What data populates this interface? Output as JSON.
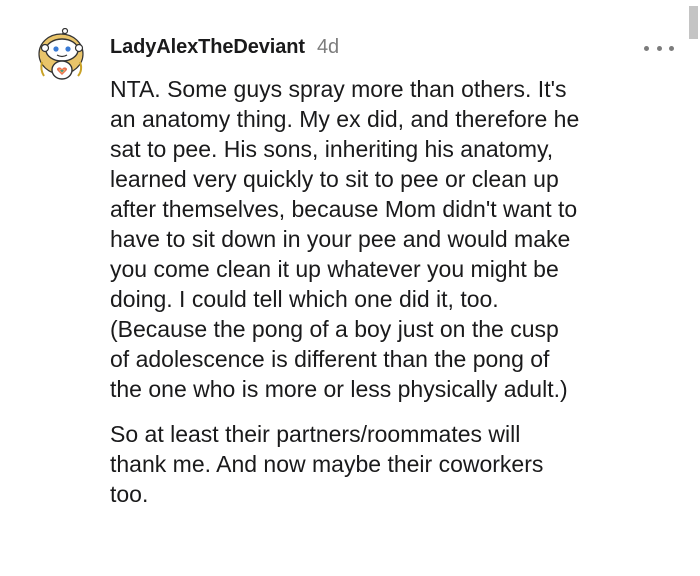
{
  "comment": {
    "username": "LadyAlexTheDeviant",
    "timestamp": "4d",
    "more_icon": "more-options-icon",
    "avatar_icon": "reddit-snoo-avatar-icon",
    "paragraphs": [
      {
        "lines": [
          "NTA. Some guys spray more than others. It's",
          "an anatomy thing. My ex did, and therefore he",
          "sat to pee. His sons, inheriting his anatomy,",
          "learned very quickly to sit to pee or clean up",
          "after themselves, because Mom didn't want to",
          "have to sit down in your pee and would make",
          "you come clean it up whatever you might be",
          "doing. I could tell which one did it, too.",
          "(Because the pong of a boy just on the cusp",
          "of adolescence is different than the pong of",
          "the one who is more or less physically adult.)"
        ]
      },
      {
        "lines": [
          "So at least their partners/roommates will",
          "thank me. And now maybe their coworkers",
          "too."
        ]
      }
    ]
  },
  "colors": {
    "text": "#1a1a1b",
    "meta": "#7c7c7c",
    "background": "#ffffff"
  }
}
